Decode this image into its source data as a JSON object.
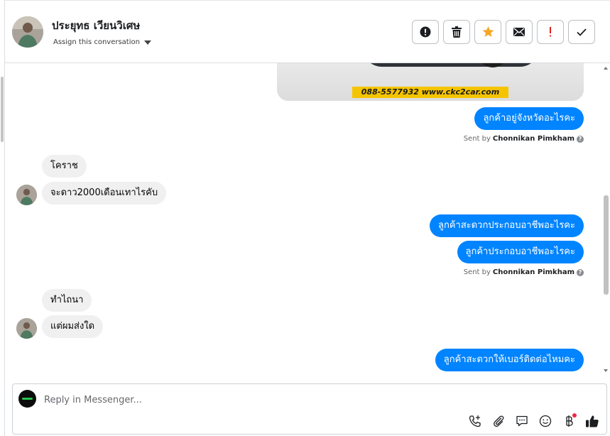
{
  "header": {
    "contact_name": "ประยุทธ เวียนวิเศษ",
    "assign_label": "Assign this conversation",
    "actions": [
      {
        "name": "report-spam-button",
        "icon": "exclamation-circle-icon"
      },
      {
        "name": "delete-button",
        "icon": "trash-icon"
      },
      {
        "name": "star-button",
        "icon": "star-icon",
        "color": "#f5a623"
      },
      {
        "name": "mark-unread-button",
        "icon": "envelope-icon"
      },
      {
        "name": "follow-up-button",
        "icon": "exclamation-icon",
        "color": "#e02020"
      },
      {
        "name": "mark-done-button",
        "icon": "check-icon"
      }
    ]
  },
  "messages": {
    "image_banner": "088-5577932 www.ckc2car.com",
    "m1": "ลูกค้าอยู่จังหวัดอะไรคะ",
    "sent1_prefix": "Sent by",
    "sent1_author": "Chonnikan Pimkham",
    "m2": "โคราช",
    "m3": "จะดาว2000เดือนเทาไรคับ",
    "m4": "ลูกค้าสะดวกประกอบอาชีพอะไรคะ",
    "m5": "ลูกค้าประกอบอาชีพอะไรคะ",
    "sent2_prefix": "Sent by",
    "sent2_author": "Chonnikan Pimkham",
    "m6": "ทำไถนา",
    "m7": "แต่ผมส่งใด",
    "m8": "ลูกค้าสะดวกให้เบอร์ติดต่อไหมคะ"
  },
  "composer": {
    "placeholder": "Reply in Messenger...",
    "tools": [
      "add-call-icon",
      "attachment-icon",
      "saved-reply-icon",
      "emoji-icon",
      "baht-payment-icon",
      "like-icon"
    ]
  },
  "colors": {
    "outgoing_bubble": "#0084ff",
    "incoming_bubble": "#f0f0f0",
    "star": "#f5a623",
    "alert": "#e02020"
  }
}
